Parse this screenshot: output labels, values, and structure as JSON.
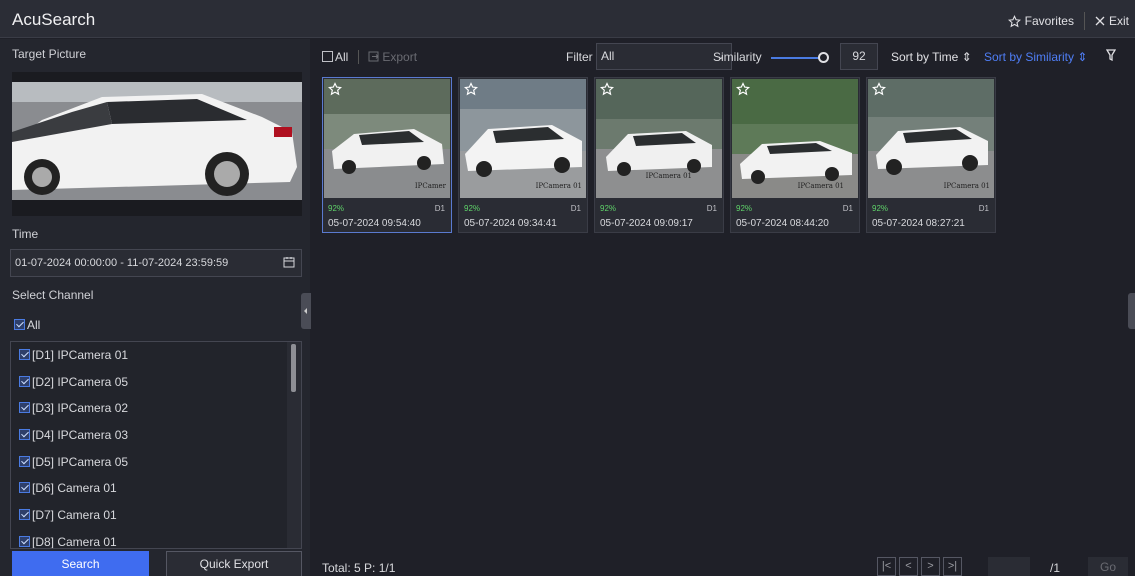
{
  "header": {
    "title": "AcuSearch",
    "favorites_label": "Favorites",
    "exit_label": "Exit"
  },
  "left": {
    "target_label": "Target Picture",
    "time_label": "Time",
    "time_value": "01-07-2024 00:00:00 - 11-07-2024 23:59:59",
    "channel_label": "Select Channel",
    "all_label": "All",
    "channels": [
      "[D1] IPCamera 01",
      "[D2] IPCamera 05",
      "[D3] IPCamera 02",
      "[D4] IPCamera 03",
      "[D5] IPCamera 05",
      "[D6] Camera 01",
      "[D7] Camera 01",
      "[D8] Camera 01"
    ],
    "search_label": "Search",
    "quick_export_label": "Quick Export"
  },
  "toolbar": {
    "all_label": "All",
    "export_label": "Export",
    "filter_label": "Filter",
    "filter_value": "All",
    "similarity_label": "Similarity",
    "similarity_value": "92",
    "similarity_level": 92,
    "sort_time_label": "Sort by Time",
    "sort_similarity_label": "Sort by Similarity"
  },
  "results": [
    {
      "pct": "92%",
      "channel": "D1",
      "time": "05-07-2024 09:54:40",
      "tag": "IPCamer"
    },
    {
      "pct": "92%",
      "channel": "D1",
      "time": "05-07-2024 09:34:41",
      "tag": "IPCamera 01"
    },
    {
      "pct": "92%",
      "channel": "D1",
      "time": "05-07-2024 09:09:17",
      "tag": "IPCamera 01"
    },
    {
      "pct": "92%",
      "channel": "D1",
      "time": "05-07-2024 08:44:20",
      "tag": "IPCamera 01"
    },
    {
      "pct": "92%",
      "channel": "D1",
      "time": "05-07-2024 08:27:21",
      "tag": "IPCamera 01"
    }
  ],
  "footer": {
    "total": "Total: 5  P: 1/1",
    "page_total": "/1",
    "go_label": "Go"
  },
  "colors": {
    "accent": "#3f6cf0",
    "sort_active": "#4f7ef6",
    "similarity_green": "#5fd36a"
  }
}
